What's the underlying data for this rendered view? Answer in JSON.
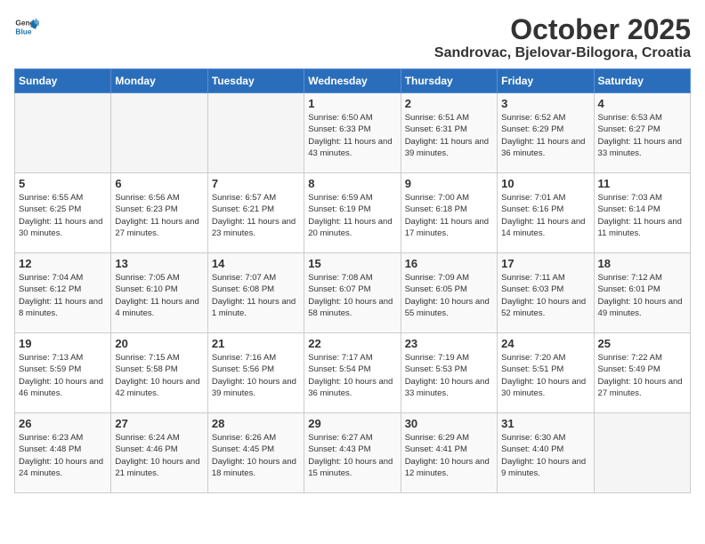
{
  "header": {
    "logo_general": "General",
    "logo_blue": "Blue",
    "title": "October 2025",
    "subtitle": "Sandrovac, Bjelovar-Bilogora, Croatia"
  },
  "weekdays": [
    "Sunday",
    "Monday",
    "Tuesday",
    "Wednesday",
    "Thursday",
    "Friday",
    "Saturday"
  ],
  "weeks": [
    [
      {
        "day": "",
        "info": ""
      },
      {
        "day": "",
        "info": ""
      },
      {
        "day": "",
        "info": ""
      },
      {
        "day": "1",
        "info": "Sunrise: 6:50 AM\nSunset: 6:33 PM\nDaylight: 11 hours and 43 minutes."
      },
      {
        "day": "2",
        "info": "Sunrise: 6:51 AM\nSunset: 6:31 PM\nDaylight: 11 hours and 39 minutes."
      },
      {
        "day": "3",
        "info": "Sunrise: 6:52 AM\nSunset: 6:29 PM\nDaylight: 11 hours and 36 minutes."
      },
      {
        "day": "4",
        "info": "Sunrise: 6:53 AM\nSunset: 6:27 PM\nDaylight: 11 hours and 33 minutes."
      }
    ],
    [
      {
        "day": "5",
        "info": "Sunrise: 6:55 AM\nSunset: 6:25 PM\nDaylight: 11 hours and 30 minutes."
      },
      {
        "day": "6",
        "info": "Sunrise: 6:56 AM\nSunset: 6:23 PM\nDaylight: 11 hours and 27 minutes."
      },
      {
        "day": "7",
        "info": "Sunrise: 6:57 AM\nSunset: 6:21 PM\nDaylight: 11 hours and 23 minutes."
      },
      {
        "day": "8",
        "info": "Sunrise: 6:59 AM\nSunset: 6:19 PM\nDaylight: 11 hours and 20 minutes."
      },
      {
        "day": "9",
        "info": "Sunrise: 7:00 AM\nSunset: 6:18 PM\nDaylight: 11 hours and 17 minutes."
      },
      {
        "day": "10",
        "info": "Sunrise: 7:01 AM\nSunset: 6:16 PM\nDaylight: 11 hours and 14 minutes."
      },
      {
        "day": "11",
        "info": "Sunrise: 7:03 AM\nSunset: 6:14 PM\nDaylight: 11 hours and 11 minutes."
      }
    ],
    [
      {
        "day": "12",
        "info": "Sunrise: 7:04 AM\nSunset: 6:12 PM\nDaylight: 11 hours and 8 minutes."
      },
      {
        "day": "13",
        "info": "Sunrise: 7:05 AM\nSunset: 6:10 PM\nDaylight: 11 hours and 4 minutes."
      },
      {
        "day": "14",
        "info": "Sunrise: 7:07 AM\nSunset: 6:08 PM\nDaylight: 11 hours and 1 minute."
      },
      {
        "day": "15",
        "info": "Sunrise: 7:08 AM\nSunset: 6:07 PM\nDaylight: 10 hours and 58 minutes."
      },
      {
        "day": "16",
        "info": "Sunrise: 7:09 AM\nSunset: 6:05 PM\nDaylight: 10 hours and 55 minutes."
      },
      {
        "day": "17",
        "info": "Sunrise: 7:11 AM\nSunset: 6:03 PM\nDaylight: 10 hours and 52 minutes."
      },
      {
        "day": "18",
        "info": "Sunrise: 7:12 AM\nSunset: 6:01 PM\nDaylight: 10 hours and 49 minutes."
      }
    ],
    [
      {
        "day": "19",
        "info": "Sunrise: 7:13 AM\nSunset: 5:59 PM\nDaylight: 10 hours and 46 minutes."
      },
      {
        "day": "20",
        "info": "Sunrise: 7:15 AM\nSunset: 5:58 PM\nDaylight: 10 hours and 42 minutes."
      },
      {
        "day": "21",
        "info": "Sunrise: 7:16 AM\nSunset: 5:56 PM\nDaylight: 10 hours and 39 minutes."
      },
      {
        "day": "22",
        "info": "Sunrise: 7:17 AM\nSunset: 5:54 PM\nDaylight: 10 hours and 36 minutes."
      },
      {
        "day": "23",
        "info": "Sunrise: 7:19 AM\nSunset: 5:53 PM\nDaylight: 10 hours and 33 minutes."
      },
      {
        "day": "24",
        "info": "Sunrise: 7:20 AM\nSunset: 5:51 PM\nDaylight: 10 hours and 30 minutes."
      },
      {
        "day": "25",
        "info": "Sunrise: 7:22 AM\nSunset: 5:49 PM\nDaylight: 10 hours and 27 minutes."
      }
    ],
    [
      {
        "day": "26",
        "info": "Sunrise: 6:23 AM\nSunset: 4:48 PM\nDaylight: 10 hours and 24 minutes."
      },
      {
        "day": "27",
        "info": "Sunrise: 6:24 AM\nSunset: 4:46 PM\nDaylight: 10 hours and 21 minutes."
      },
      {
        "day": "28",
        "info": "Sunrise: 6:26 AM\nSunset: 4:45 PM\nDaylight: 10 hours and 18 minutes."
      },
      {
        "day": "29",
        "info": "Sunrise: 6:27 AM\nSunset: 4:43 PM\nDaylight: 10 hours and 15 minutes."
      },
      {
        "day": "30",
        "info": "Sunrise: 6:29 AM\nSunset: 4:41 PM\nDaylight: 10 hours and 12 minutes."
      },
      {
        "day": "31",
        "info": "Sunrise: 6:30 AM\nSunset: 4:40 PM\nDaylight: 10 hours and 9 minutes."
      },
      {
        "day": "",
        "info": ""
      }
    ]
  ]
}
